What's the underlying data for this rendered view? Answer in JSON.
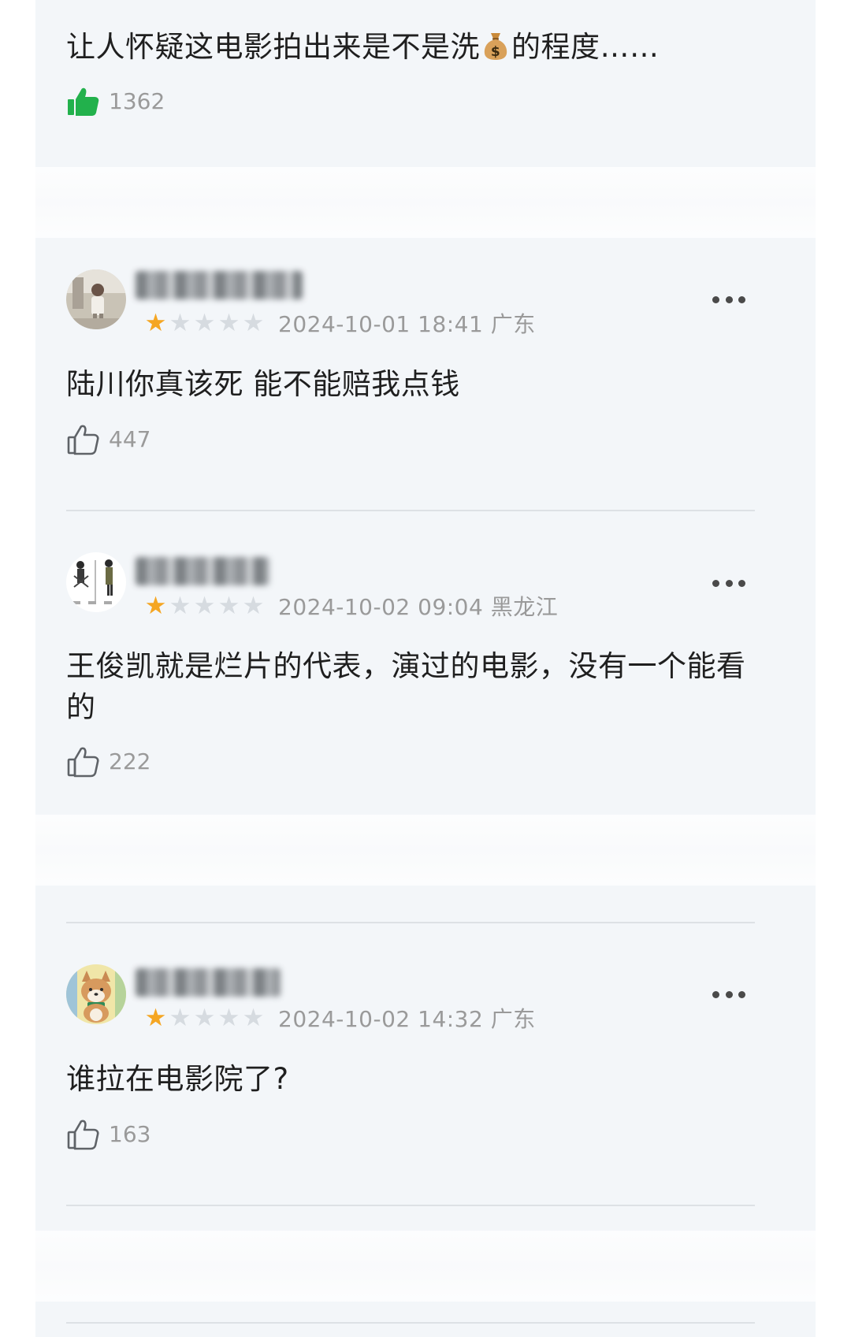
{
  "top_comment": {
    "text_before": "让人怀疑这电影拍出来是不是洗",
    "emoji": "money-bag",
    "text_after": "的程度……",
    "likes": "1362",
    "liked": true
  },
  "comments": [
    {
      "rating": 1,
      "datetime": "2024-10-01 18:41",
      "region": "广东",
      "text": "陆川你真该死 能不能赔我点钱",
      "likes": "447"
    },
    {
      "rating": 1,
      "datetime": "2024-10-02 09:04",
      "region": "黑龙江",
      "text": "王俊凯就是烂片的代表，演过的电影，没有一个能看的",
      "likes": "222"
    },
    {
      "rating": 1,
      "datetime": "2024-10-02 14:32",
      "region": "广东",
      "text": "谁拉在电影院了?",
      "likes": "163"
    }
  ],
  "icons": {
    "like_filled": "thumbs-up-filled-icon",
    "like_outline": "thumbs-up-outline-icon",
    "more": "more-dots-icon",
    "star": "star-icon"
  },
  "colors": {
    "card_bg": "#f3f6f9",
    "like_active": "#22b14c",
    "star_on": "#f5a623",
    "star_off": "#d6dbe0",
    "meta_text": "#9a9a9a"
  }
}
